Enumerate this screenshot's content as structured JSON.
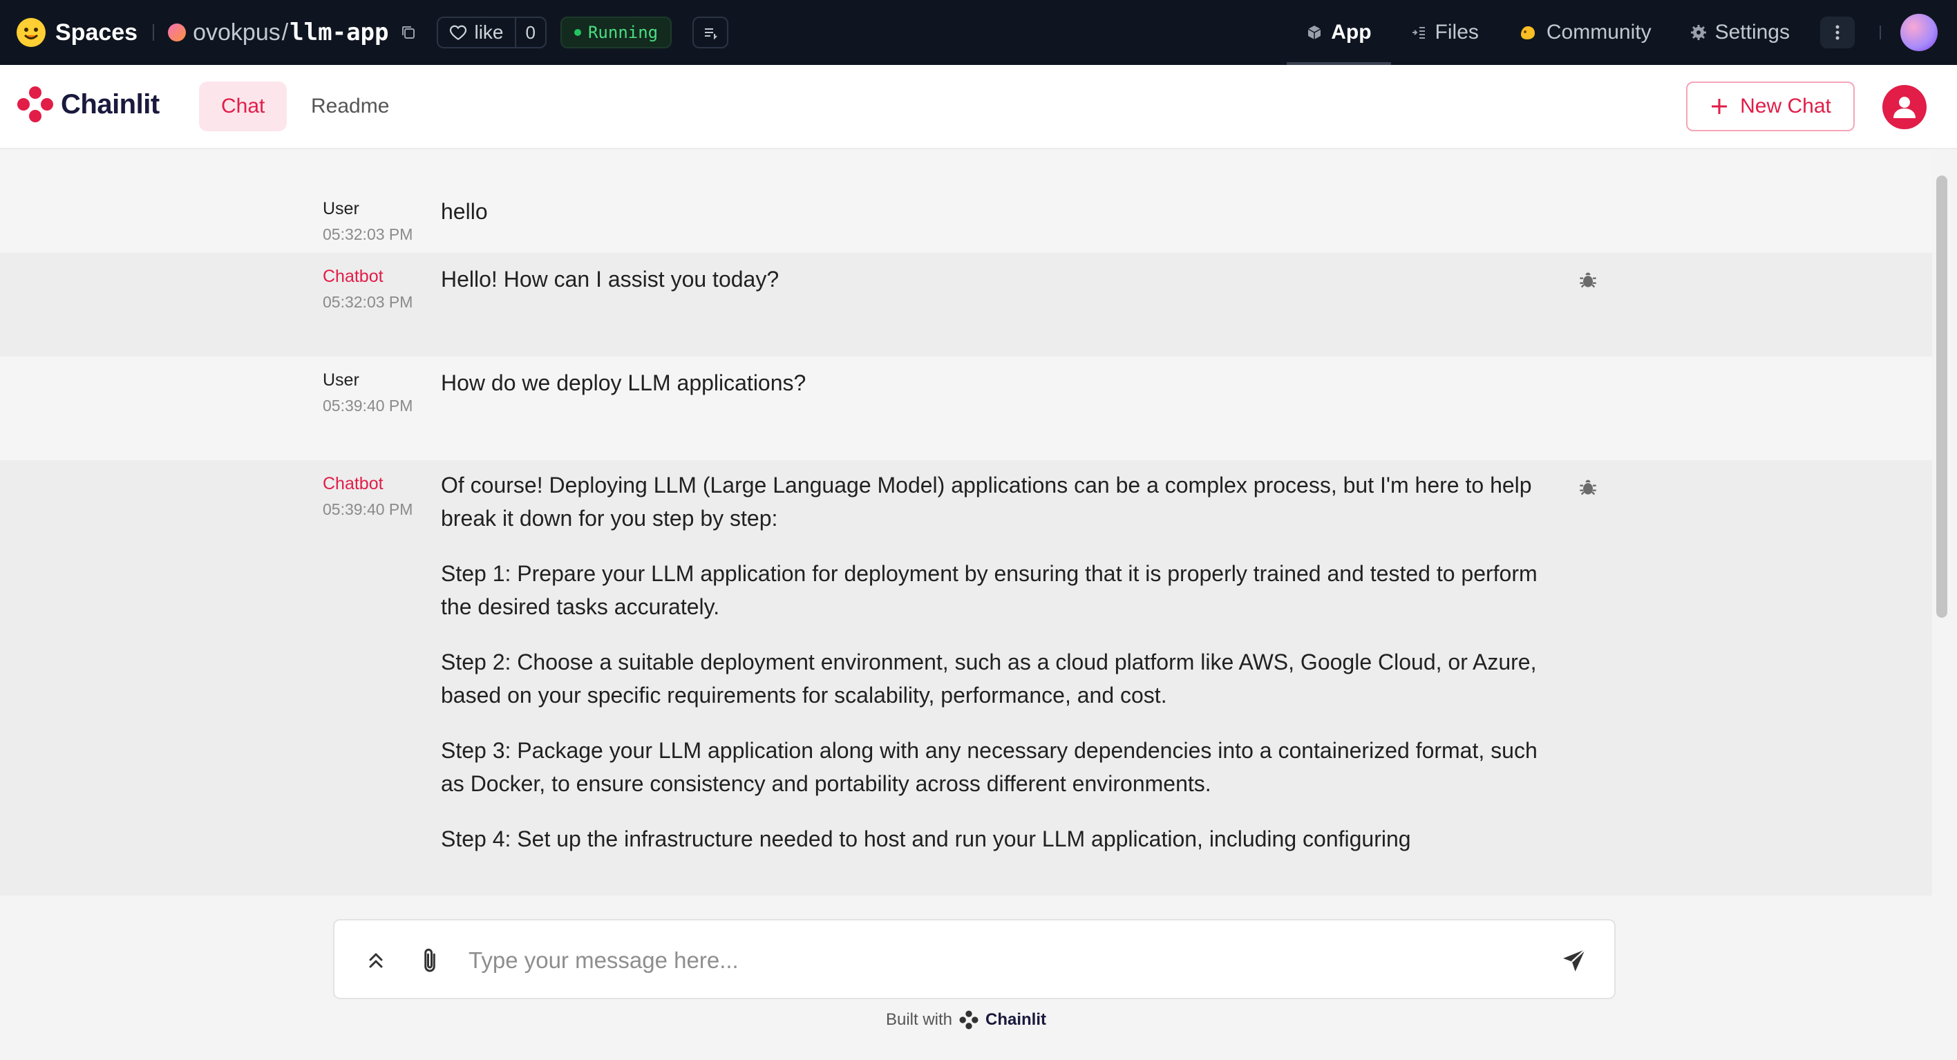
{
  "hf": {
    "spaces_label": "Spaces",
    "owner": "ovokpus",
    "separator": "/",
    "repo": "llm-app",
    "like_label": "like",
    "like_count": "0",
    "status": "Running",
    "nav": [
      {
        "label": "App",
        "icon": "cube-icon"
      },
      {
        "label": "Files",
        "icon": "files-icon"
      },
      {
        "label": "Community",
        "icon": "community-icon"
      },
      {
        "label": "Settings",
        "icon": "gear-icon"
      }
    ]
  },
  "chainlit": {
    "brand": "Chainlit",
    "tabs": {
      "chat": "Chat",
      "readme": "Readme"
    },
    "new_chat_label": "New Chat"
  },
  "messages": [
    {
      "author": "User",
      "time": "05:32:03 PM",
      "paragraphs": [
        "hello"
      ]
    },
    {
      "author": "Chatbot",
      "time": "05:32:03 PM",
      "paragraphs": [
        "Hello! How can I assist you today?"
      ]
    },
    {
      "author": "User",
      "time": "05:39:40 PM",
      "paragraphs": [
        "How do we deploy LLM applications?"
      ]
    },
    {
      "author": "Chatbot",
      "time": "05:39:40 PM",
      "paragraphs": [
        "Of course! Deploying LLM (Large Language Model) applications can be a complex process, but I'm here to help break it down for you step by step:",
        "Step 1: Prepare your LLM application for deployment by ensuring that it is properly trained and tested to perform the desired tasks accurately.",
        "Step 2: Choose a suitable deployment environment, such as a cloud platform like AWS, Google Cloud, or Azure, based on your specific requirements for scalability, performance, and cost.",
        "Step 3: Package your LLM application along with any necessary dependencies into a containerized format, such as Docker, to ensure consistency and portability across different environments.",
        "Step 4: Set up the infrastructure needed to host and run your LLM application, including configuring"
      ]
    }
  ],
  "composer": {
    "placeholder": "Type your message here..."
  },
  "footer": {
    "built_with": "Built with",
    "brand": "Chainlit"
  },
  "colors": {
    "accent": "#e11d48",
    "hf_bar": "#0f1520",
    "running": "#4ade80"
  }
}
